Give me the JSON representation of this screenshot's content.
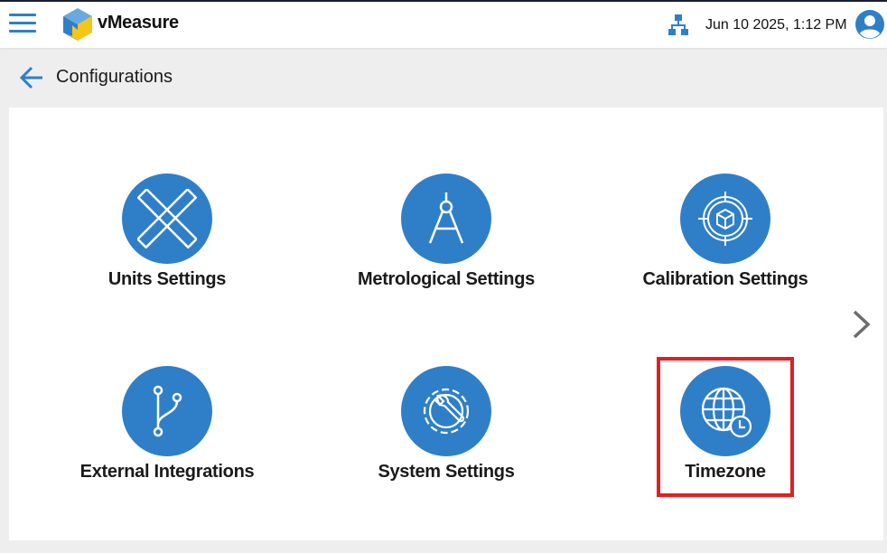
{
  "header": {
    "brand": "vMeasure",
    "datetime": "Jun 10 2025, 1:12 PM"
  },
  "page": {
    "title": "Configurations"
  },
  "tiles": [
    {
      "label": "Units Settings",
      "icon": "rulers-icon"
    },
    {
      "label": "Metrological Settings",
      "icon": "compass-icon"
    },
    {
      "label": "Calibration Settings",
      "icon": "target-box-icon"
    },
    {
      "label": "External Integrations",
      "icon": "branch-icon"
    },
    {
      "label": "System Settings",
      "icon": "wrench-gear-icon"
    },
    {
      "label": "Timezone",
      "icon": "globe-clock-icon"
    }
  ],
  "colors": {
    "accent": "#2f7fc8",
    "highlight": "#e31e24"
  }
}
